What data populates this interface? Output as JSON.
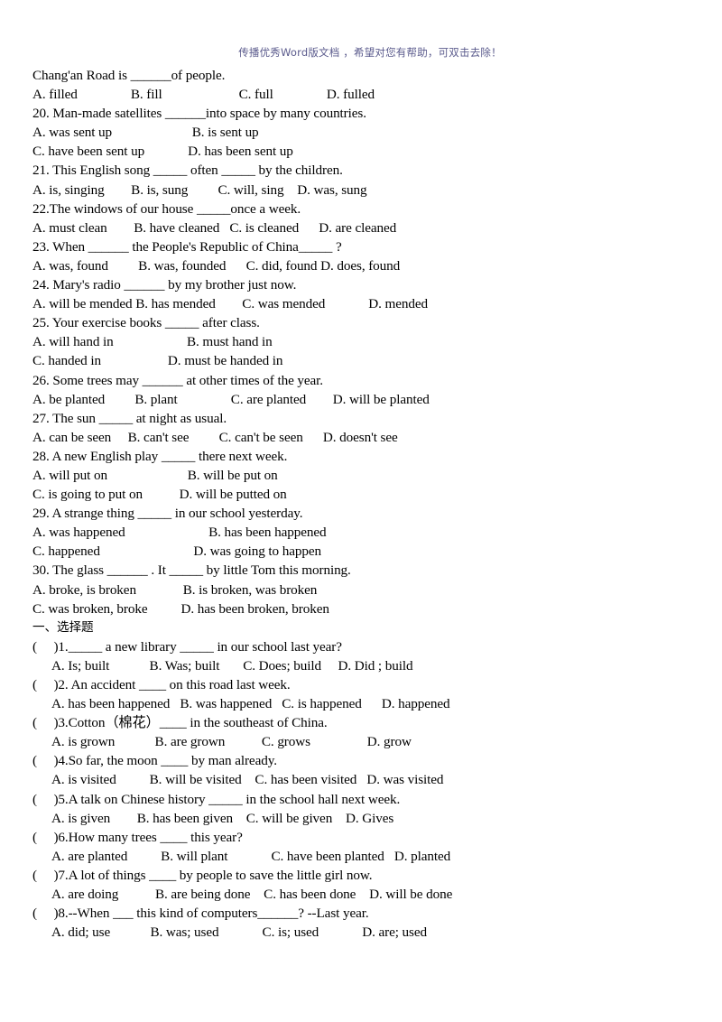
{
  "document": {
    "watermark_header": "传播优秀Word版文档 ，希望对您有帮助，可双击去除！",
    "section_heading": "一、选择题",
    "lines": [
      {
        "id": "l01",
        "text": "Chang'an Road is ______of people."
      },
      {
        "id": "l02",
        "text": "A. filled                B. fill                       C. full                D. fulled"
      },
      {
        "id": "l03",
        "text": "20. Man-made satellites ______into space by many countries."
      },
      {
        "id": "l04",
        "text": "A. was sent up                        B. is sent up"
      },
      {
        "id": "l05",
        "text": "C. have been sent up             D. has been sent up"
      },
      {
        "id": "l06",
        "text": "21. This English song _____ often _____ by the children."
      },
      {
        "id": "l07",
        "text": "A. is, singing        B. is, sung         C. will, sing    D. was, sung"
      },
      {
        "id": "l08",
        "text": "22.The windows of our house _____once a week."
      },
      {
        "id": "l09",
        "text": "A. must clean        B. have cleaned   C. is cleaned      D. are cleaned"
      },
      {
        "id": "l10",
        "text": "23. When ______ the People's Republic of China_____ ?"
      },
      {
        "id": "l11",
        "text": "A. was, found         B. was, founded      C. did, found D. does, found"
      },
      {
        "id": "l12",
        "text": "24. Mary's radio ______ by my brother just now."
      },
      {
        "id": "l13",
        "text": "A. will be mended B. has mended        C. was mended             D. mended"
      },
      {
        "id": "l14",
        "text": "25. Your exercise books _____ after class."
      },
      {
        "id": "l15",
        "text": "A. will hand in                      B. must hand in"
      },
      {
        "id": "l16",
        "text": "C. handed in                    D. must be handed in"
      },
      {
        "id": "l17",
        "text": "26. Some trees may ______ at other times of the year."
      },
      {
        "id": "l18",
        "text": "A. be planted         B. plant                C. are planted        D. will be planted"
      },
      {
        "id": "l19",
        "text": "27. The sun _____ at night as usual."
      },
      {
        "id": "l20",
        "text": "A. can be seen     B. can't see         C. can't be seen      D. doesn't see"
      },
      {
        "id": "l21",
        "text": "28. A new English play _____ there next week."
      },
      {
        "id": "l22",
        "text": "A. will put on                        B. will be put on"
      },
      {
        "id": "l23",
        "text": "C. is going to put on           D. will be putted on"
      },
      {
        "id": "l24",
        "text": "29. A strange thing _____ in our school yesterday."
      },
      {
        "id": "l25",
        "text": "A. was happened                         B. has been happened"
      },
      {
        "id": "l26",
        "text": "C. happened                            D. was going to happen"
      },
      {
        "id": "l27",
        "text": "30. The glass ______ . It _____ by little Tom this morning."
      },
      {
        "id": "l28",
        "text": "A. broke, is broken              B. is broken, was broken"
      },
      {
        "id": "l29",
        "text": "C. was broken, broke          D. has been broken, broken"
      }
    ],
    "section_two_lines": [
      {
        "id": "q1",
        "indent": false,
        "text": "(     )1._____ a new library _____ in our school last year?"
      },
      {
        "id": "q1o",
        "indent": true,
        "text": "A. Is; built            B. Was; built       C. Does; build     D. Did ; build"
      },
      {
        "id": "q2",
        "indent": false,
        "text": "(     )2. An accident ____ on this road last week."
      },
      {
        "id": "q2o",
        "indent": true,
        "text": "A. has been happened   B. was happened   C. is happened      D. happened"
      },
      {
        "id": "q3",
        "indent": false,
        "text": "(     )3.Cotton（棉花）____ in the southeast of China.",
        "has_cn": true
      },
      {
        "id": "q3o",
        "indent": true,
        "text": "A. is grown            B. are grown           C. grows                 D. grow"
      },
      {
        "id": "q4",
        "indent": false,
        "text": "(     )4.So far, the moon ____ by man already."
      },
      {
        "id": "q4o",
        "indent": true,
        "text": "A. is visited          B. will be visited    C. has been visited   D. was visited"
      },
      {
        "id": "q5",
        "indent": false,
        "text": "(     )5.A talk on Chinese history _____ in the school hall next week."
      },
      {
        "id": "q5o",
        "indent": true,
        "text": "A. is given        B. has been given    C. will be given    D. Gives"
      },
      {
        "id": "q6",
        "indent": false,
        "text": "(     )6.How many trees ____ this year?"
      },
      {
        "id": "q6o",
        "indent": true,
        "text": "A. are planted          B. will plant             C. have been planted   D. planted"
      },
      {
        "id": "q7",
        "indent": false,
        "text": "(     )7.A lot of things ____ by people to save the little girl now."
      },
      {
        "id": "q7o",
        "indent": true,
        "text": "A. are doing           B. are being done    C. has been done    D. will be done"
      },
      {
        "id": "q8",
        "indent": false,
        "text": "(     )8.--When ___ this kind of computers______? --Last year."
      },
      {
        "id": "q8o",
        "indent": true,
        "text": "A. did; use            B. was; used             C. is; used             D. are; used"
      }
    ]
  }
}
